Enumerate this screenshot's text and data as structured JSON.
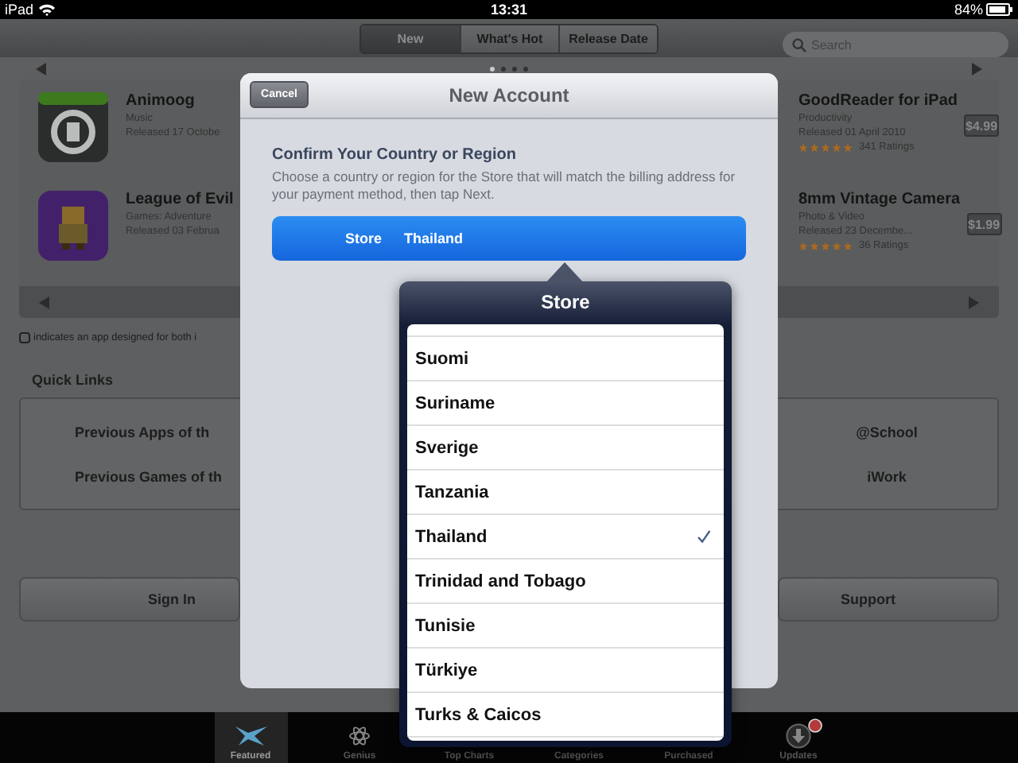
{
  "status_bar": {
    "device": "iPad",
    "time": "13:31",
    "battery": "84%"
  },
  "segments": [
    {
      "label": "New",
      "selected": true
    },
    {
      "label": "What's Hot",
      "selected": false
    },
    {
      "label": "Release Date",
      "selected": false
    }
  ],
  "search": {
    "placeholder": "Search"
  },
  "page_dots": [
    {
      "selected": true
    },
    {
      "selected": false
    },
    {
      "selected": false
    },
    {
      "selected": false
    }
  ],
  "apps_left": [
    {
      "name": "Animoog",
      "category": "Music",
      "released": "Released 17 Octobe",
      "kind": "synth"
    },
    {
      "name": "League of Evil",
      "category": "Games: Adventure",
      "released": "Released 03 Februa",
      "kind": "game"
    }
  ],
  "apps_right": [
    {
      "name": "GoodReader for iPad",
      "category": "Productivity",
      "released": "Released 01 April 2010",
      "stars": 5,
      "ratings": "341 Ratings",
      "price": "$4.99"
    },
    {
      "name": "8mm Vintage Camera",
      "category": "Photo & Video",
      "released": "Released 23 Decembe...",
      "stars": 5,
      "ratings": "36 Ratings",
      "price": "$1.99"
    }
  ],
  "footnote": "indicates an app designed for both i",
  "quick_links": {
    "title": "Quick Links",
    "left": [
      "Previous Apps of th",
      "Previous Games of th"
    ],
    "right": [
      "@School",
      "iWork"
    ]
  },
  "buttons": [
    "Sign In",
    "Support"
  ],
  "modal": {
    "cancel": "Cancel",
    "title": "New Account",
    "heading": "Confirm Your Country or Region",
    "description": "Choose a country or region for the Store that will match the billing address for your payment method, then tap Next.",
    "field_label": "Store",
    "field_value": "Thailand"
  },
  "picker": {
    "title": "Store",
    "items": [
      {
        "label": "Suomi",
        "selected": false
      },
      {
        "label": "Suriname",
        "selected": false
      },
      {
        "label": "Sverige",
        "selected": false
      },
      {
        "label": "Tanzania",
        "selected": false
      },
      {
        "label": "Thailand",
        "selected": true
      },
      {
        "label": "Trinidad and Tobago",
        "selected": false
      },
      {
        "label": "Tunisie",
        "selected": false
      },
      {
        "label": "Türkiye",
        "selected": false
      },
      {
        "label": "Turks & Caicos",
        "selected": false
      }
    ]
  },
  "tab_bar": [
    {
      "label": "Featured",
      "selected": true,
      "kind": "featured"
    },
    {
      "label": "Genius",
      "selected": false,
      "kind": "genius"
    },
    {
      "label": "Top Charts",
      "selected": false
    },
    {
      "label": "Categories",
      "selected": false
    },
    {
      "label": "Purchased",
      "selected": false
    },
    {
      "label": "Updates",
      "selected": false,
      "kind": "updates"
    }
  ]
}
